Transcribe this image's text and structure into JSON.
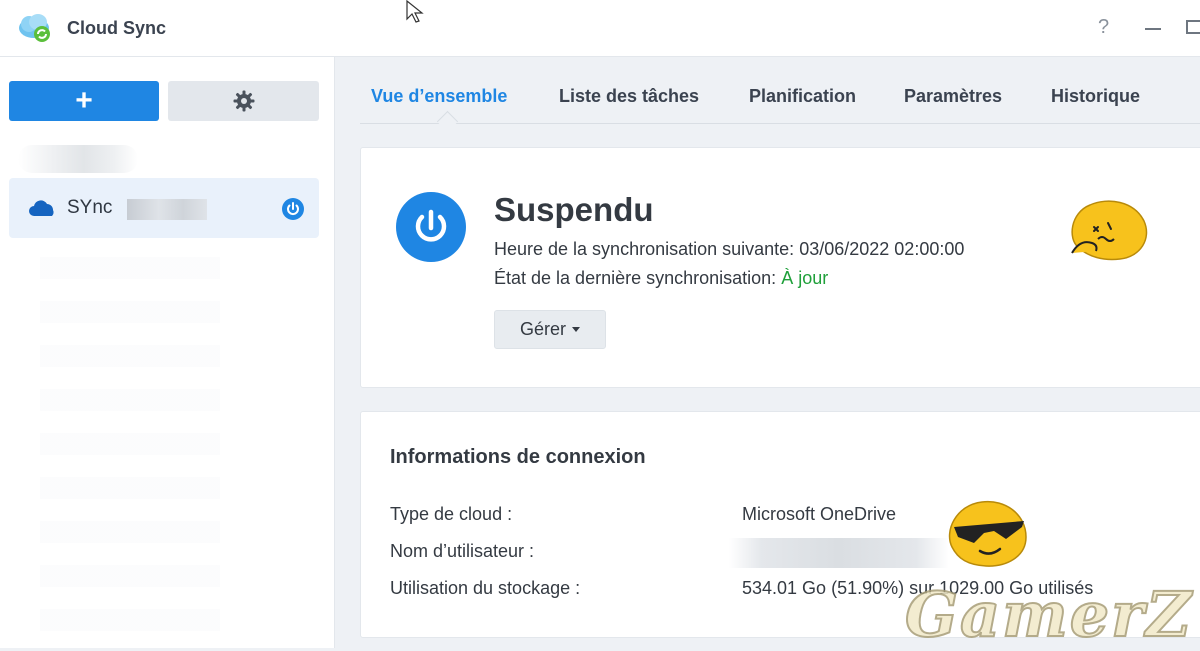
{
  "app": {
    "title": "Cloud Sync"
  },
  "window": {
    "help": "?"
  },
  "sidebar": {
    "add_label": "+",
    "item": {
      "label": "SYnc"
    }
  },
  "tabs": [
    {
      "label": "Vue d’ensemble",
      "active": true
    },
    {
      "label": "Liste des tâches"
    },
    {
      "label": "Planification"
    },
    {
      "label": "Paramètres"
    },
    {
      "label": "Historique"
    }
  ],
  "status": {
    "title": "Suspendu",
    "next_sync_label": "Heure de la synchronisation suivante:",
    "next_sync_value": "03/06/2022 02:00:00",
    "last_sync_label": "État de la dernière synchronisation:",
    "last_sync_value": "À jour",
    "manage_label": "Gérer"
  },
  "connection": {
    "title": "Informations de connexion",
    "rows": [
      {
        "label": "Type de cloud :",
        "value": "Microsoft OneDrive"
      },
      {
        "label": "Nom d’utilisateur :",
        "value": ""
      },
      {
        "label": "Utilisation du stockage :",
        "value": "534.01 Go (51.90%) sur 1029.00 Go utilisés"
      }
    ]
  },
  "watermark": "GamerZ",
  "colors": {
    "accent": "#1f86e3",
    "success": "#1fa03a",
    "background": "#eef1f5"
  }
}
